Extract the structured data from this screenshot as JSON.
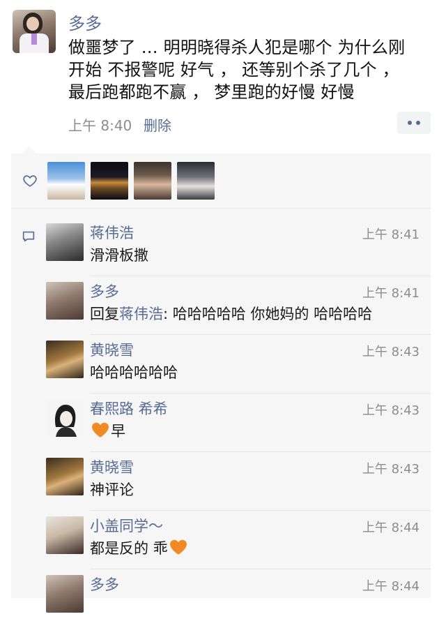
{
  "post": {
    "author": "多多",
    "text_lines": [
      "做噩梦了 … 明明晓得杀人犯是哪个 为什么刚",
      "开始 不报警呢 好气 ， 还等别个杀了几个 ，",
      "最后跑都跑不赢 ， 梦里跑的好慢 好慢"
    ],
    "time": "上午 8:40",
    "delete_label": "删除"
  },
  "comments": [
    {
      "name": "蒋伟浩",
      "time": "上午 8:41",
      "text": "滑滑板撒"
    },
    {
      "name": "多多",
      "time": "上午 8:41",
      "reply_prefix": "回复",
      "reply_to": "蒋伟浩",
      "text": ": 哈哈哈哈哈 你她妈的 哈哈哈哈"
    },
    {
      "name": "黄晓雪",
      "time": "上午 8:43",
      "text": "哈哈哈哈哈哈"
    },
    {
      "name": "春熙路 希希",
      "time": "上午 8:43",
      "text": "早"
    },
    {
      "name": "黄晓雪",
      "time": "上午 8:43",
      "text": "神评论"
    },
    {
      "name": "小盖同学～",
      "time": "上午 8:44",
      "text": "都是反的 乖"
    },
    {
      "name": "多多",
      "time": "上午 8:44",
      "text": ""
    }
  ],
  "colors": {
    "link": "#576b95",
    "panel": "#f6f6f6",
    "heart_emoji": "#f08a24"
  },
  "icons": [
    "heart-icon",
    "comment-icon",
    "more-dots-icon",
    "orange-heart-emoji"
  ]
}
